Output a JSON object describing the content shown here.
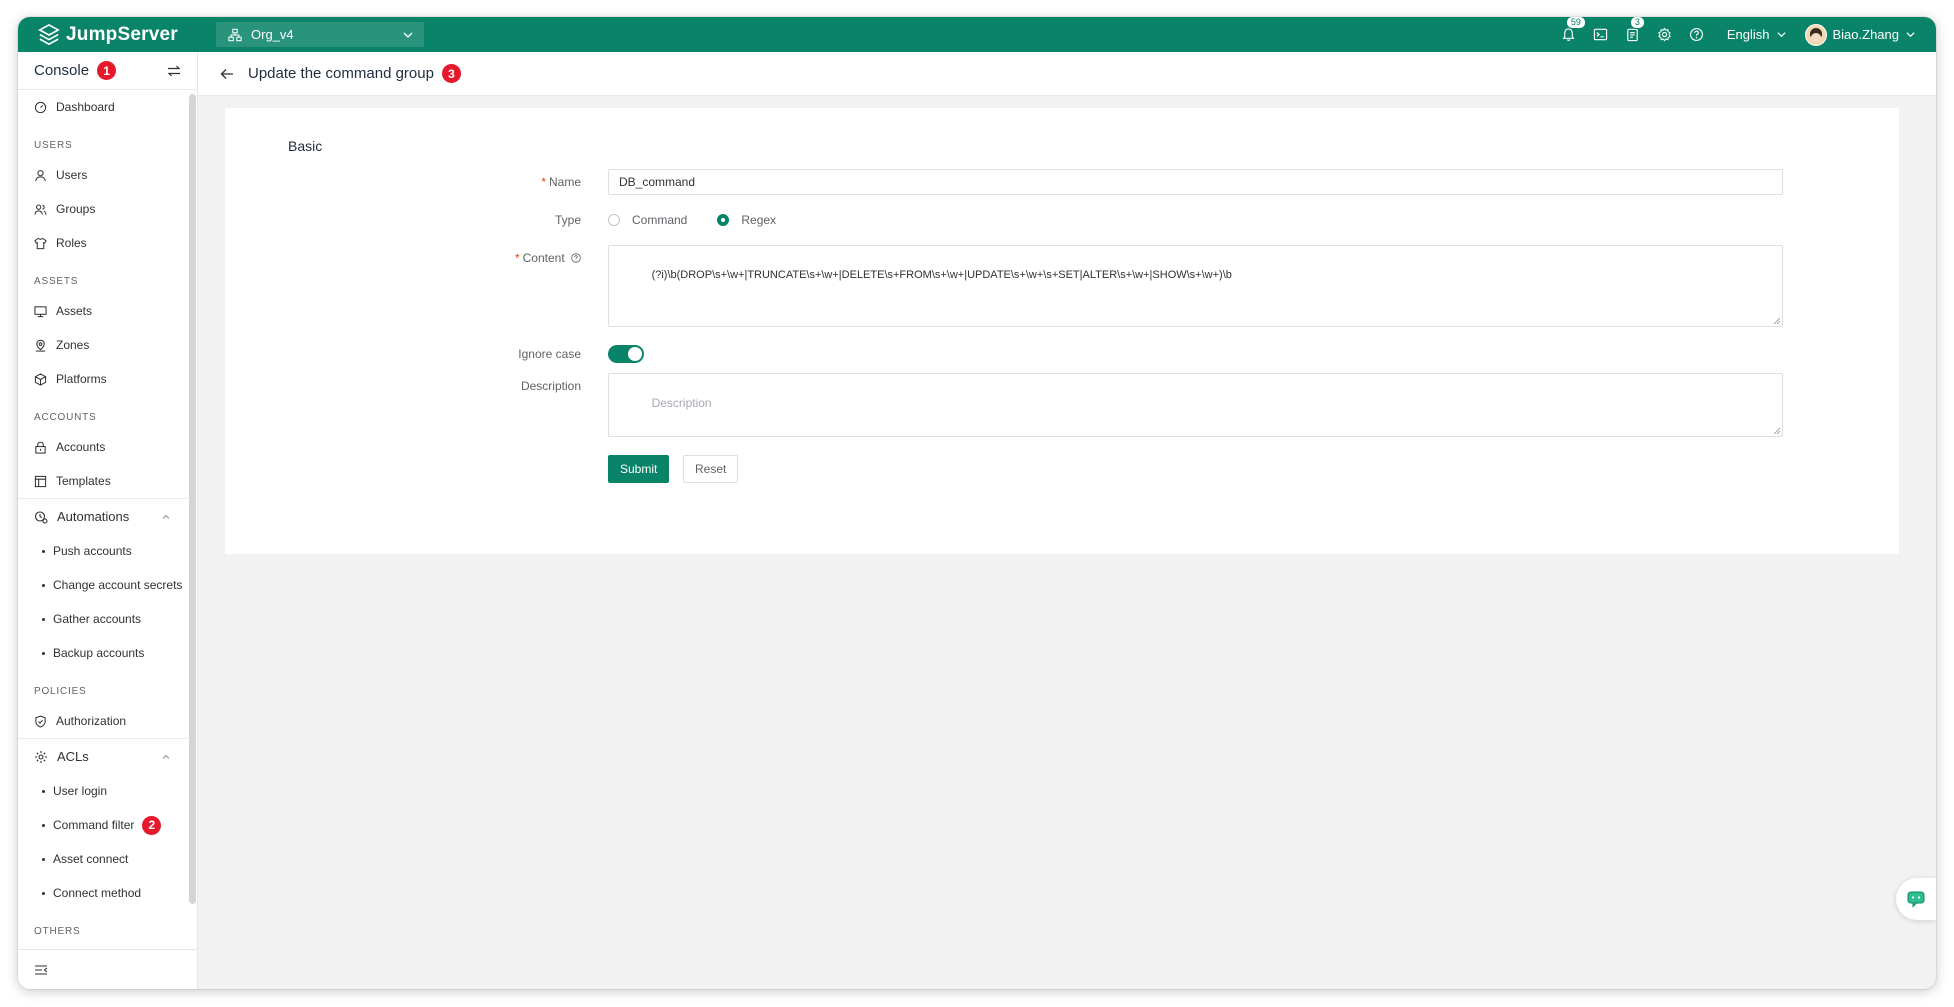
{
  "app": {
    "name": "JumpServer",
    "org": "Org_v4",
    "notifications_count": "59",
    "tasks_count": "3",
    "language": "English",
    "username": "Biao.Zhang",
    "colors": {
      "brand": "#0a8468",
      "badge": "#e5192b"
    }
  },
  "sidebar": {
    "title": "Console",
    "title_badge": "1",
    "sections": {
      "dashboard": "Dashboard",
      "users_heading": "USERS",
      "users": "Users",
      "groups": "Groups",
      "roles": "Roles",
      "assets_heading": "ASSETS",
      "assets": "Assets",
      "zones": "Zones",
      "platforms": "Platforms",
      "accounts_heading": "ACCOUNTS",
      "accounts": "Accounts",
      "templates": "Templates",
      "automations": "Automations",
      "push_accounts": "Push accounts",
      "change_secrets": "Change account secrets",
      "gather_accounts": "Gather accounts",
      "backup_accounts": "Backup accounts",
      "policies_heading": "POLICIES",
      "authorization": "Authorization",
      "acls": "ACLs",
      "user_login": "User login",
      "command_filter": "Command filter",
      "command_filter_badge": "2",
      "asset_connect": "Asset connect",
      "connect_method": "Connect method",
      "others_heading": "OTHERS"
    }
  },
  "page": {
    "title": "Update the command group",
    "title_badge": "3"
  },
  "form": {
    "section_title": "Basic",
    "name_label": "Name",
    "name_value": "DB_command",
    "type_label": "Type",
    "type_options": [
      "Command",
      "Regex"
    ],
    "type_selected": "Regex",
    "content_label": "Content",
    "content_value": "(?i)\\b(DROP\\s+\\w+|TRUNCATE\\s+\\w+|DELETE\\s+FROM\\s+\\w+|UPDATE\\s+\\w+\\s+SET|ALTER\\s+\\w+|SHOW\\s+\\w+)\\b",
    "ignore_case_label": "Ignore case",
    "ignore_case_value": true,
    "description_label": "Description",
    "description_placeholder": "Description",
    "submit_label": "Submit",
    "reset_label": "Reset"
  }
}
